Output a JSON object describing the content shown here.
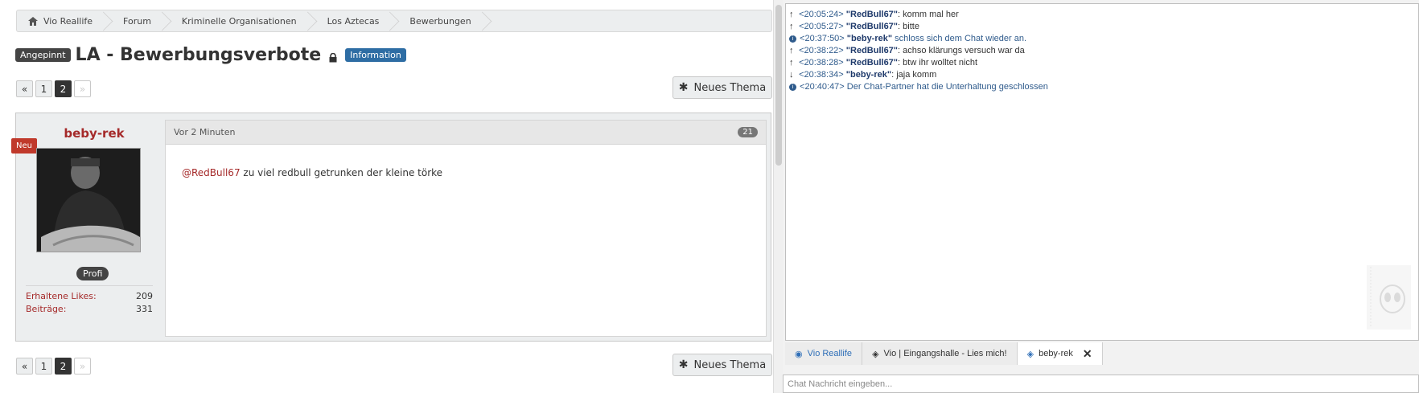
{
  "breadcrumb": [
    "Vio Reallife",
    "Forum",
    "Kriminelle Organisationen",
    "Los Aztecas",
    "Bewerbungen"
  ],
  "thread": {
    "pinned_label": "Angepinnt",
    "title": "LA - Bewerbungsverbote",
    "info_label": "Information"
  },
  "pager": {
    "first": "«",
    "pages": [
      "1",
      "2"
    ],
    "last": "»"
  },
  "new_thread_button": "Neues Thema",
  "post": {
    "author": "beby-rek",
    "new_badge": "Neu",
    "rank": "Profi",
    "stats": [
      {
        "label": "Erhaltene Likes",
        "value": "209"
      },
      {
        "label": "Beiträge",
        "value": "331"
      }
    ],
    "time": "Vor 2 Minuten",
    "number": "21",
    "mention": "@RedBull67",
    "text": " zu viel redbull getrunken der kleine törke"
  },
  "chat": {
    "messages": [
      {
        "dir": "↑",
        "time": "<20:05:24>",
        "user": "\"RedBull67\"",
        "text": ": komm mal her",
        "sys": false
      },
      {
        "dir": "↑",
        "time": "<20:05:27>",
        "user": "\"RedBull67\"",
        "text": ": bitte",
        "sys": false
      },
      {
        "dir": "i",
        "time": "<20:37:50>",
        "user": "\"beby-rek\"",
        "text": " schloss sich dem Chat wieder an.",
        "sys": true
      },
      {
        "dir": "↑",
        "time": "<20:38:22>",
        "user": "\"RedBull67\"",
        "text": ": achso klärungs versuch war da",
        "sys": false
      },
      {
        "dir": "↑",
        "time": "<20:38:28>",
        "user": "\"RedBull67\"",
        "text": ": btw ihr wolltet nicht",
        "sys": false
      },
      {
        "dir": "↓",
        "time": "<20:38:34>",
        "user": "\"beby-rek\"",
        "text": ": jaja komm",
        "sys": false
      },
      {
        "dir": "i",
        "time": "<20:40:47>",
        "user": "",
        "text": " Der Chat-Partner hat die Unterhaltung geschlossen",
        "sys": true
      }
    ],
    "tabs": [
      {
        "label": "Vio Reallife",
        "icon": "server-icon"
      },
      {
        "label": "Vio | Eingangshalle - Lies mich!",
        "icon": "channel-icon"
      },
      {
        "label": "beby-rek",
        "icon": "private-chat-icon"
      }
    ],
    "input_placeholder": "Chat Nachricht eingeben..."
  }
}
